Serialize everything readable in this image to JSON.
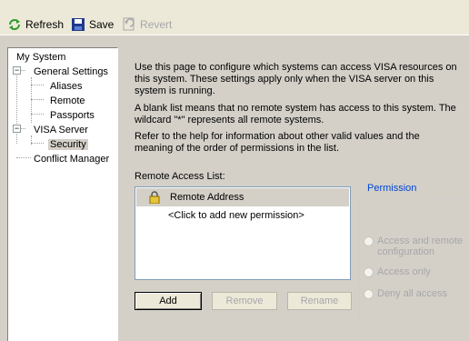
{
  "toolbar": {
    "refresh_label": "Refresh",
    "save_label": "Save",
    "revert_label": "Revert"
  },
  "tree": {
    "root": "My System",
    "general_settings": "General Settings",
    "aliases": "Aliases",
    "remote": "Remote",
    "passports": "Passports",
    "visa_server": "VISA Server",
    "security": "Security",
    "conflict_manager": "Conflict Manager"
  },
  "main": {
    "paragraph1": "Use this page to configure which systems can access VISA resources on this system.  These settings apply only when the VISA server on this system is running.",
    "paragraph2": "A blank list means that no remote system has access to this system. The wildcard \"*\" represents all remote systems.",
    "paragraph3": "Refer to the help for information about other valid values and the meaning of the order of permissions in the list.",
    "list_label": "Remote Access List:",
    "list_header": "Remote Address",
    "list_placeholder": "<Click to add new permission>",
    "add_label": "Add",
    "remove_label": "Remove",
    "rename_label": "Rename"
  },
  "permission": {
    "title": "Permission",
    "option1_line1": "Access and remote",
    "option1_line2": "configuration",
    "option2": "Access only",
    "option3": "Deny all access"
  },
  "colors": {
    "accent": "#0046d5",
    "disabled_text": "#a7a6aa",
    "background": "#d4d0c8"
  }
}
